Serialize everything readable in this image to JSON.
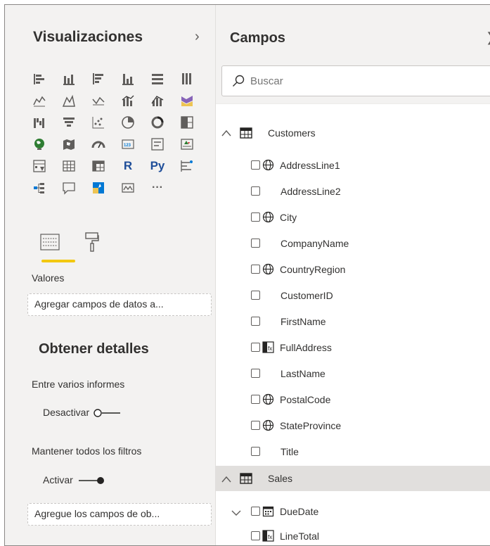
{
  "visualizations": {
    "title": "Visualizaciones",
    "collapse_icon": "chevron-right-icon",
    "icons": [
      [
        "stacked-bar-icon",
        "stacked-column-icon",
        "clustered-bar-icon",
        "clustered-column-icon",
        "100-bar-icon",
        "100-column-icon"
      ],
      [
        "line-chart-icon",
        "area-chart-icon",
        "stacked-area-icon",
        "line-column-icon",
        "line-clustered-icon",
        "ribbon-chart-icon"
      ],
      [
        "waterfall-icon",
        "funnel-icon",
        "scatter-icon",
        "pie-icon",
        "donut-icon",
        "treemap-icon"
      ],
      [
        "map-icon",
        "filled-map-icon",
        "gauge-icon",
        "card-icon",
        "multirow-card-icon",
        "kpi-icon"
      ],
      [
        "slicer-icon",
        "table-icon",
        "matrix-icon",
        "r-visual-icon",
        "python-visual-icon",
        "key-influencers-icon"
      ],
      [
        "decomposition-tree-icon",
        "qa-icon",
        "smart-narrative-icon",
        "paginated-report-icon",
        "more-icon"
      ]
    ],
    "r_label": "R",
    "py_label": "Py",
    "more_label": "···",
    "tabs": {
      "fields_tab_icon": "fields-well-icon",
      "format_tab_icon": "paint-roller-icon"
    },
    "values_label": "Valores",
    "values_well": "Agregar campos de datos a...",
    "drillthrough_title": "Obtener detalles",
    "cross_report_label": "Entre varios informes",
    "cross_report_toggle": "Desactivar",
    "keep_filters_label": "Mantener todos los filtros",
    "keep_filters_toggle": "Activar",
    "drillthrough_well": "Agregue los campos de ob..."
  },
  "fields_pane": {
    "title": "Campos",
    "close_icon": "close-icon",
    "search": {
      "placeholder": "Buscar",
      "value": ""
    },
    "tables": [
      {
        "name": "Customers",
        "expanded": true,
        "fields": [
          {
            "name": "AddressLine1",
            "icon": "globe-icon"
          },
          {
            "name": "AddressLine2",
            "icon": ""
          },
          {
            "name": "City",
            "icon": "globe-icon"
          },
          {
            "name": "CompanyName",
            "icon": ""
          },
          {
            "name": "CountryRegion",
            "icon": "globe-icon"
          },
          {
            "name": "CustomerID",
            "icon": ""
          },
          {
            "name": "FirstName",
            "icon": ""
          },
          {
            "name": "FullAddress",
            "icon": "calculated-column-icon"
          },
          {
            "name": "LastName",
            "icon": ""
          },
          {
            "name": "PostalCode",
            "icon": "globe-icon"
          },
          {
            "name": "StateProvince",
            "icon": "globe-icon"
          },
          {
            "name": "Title",
            "icon": ""
          }
        ]
      },
      {
        "name": "Sales",
        "expanded": true,
        "fields": [
          {
            "name": "DueDate",
            "icon": "calendar-icon",
            "expandable": true
          },
          {
            "name": "LineTotal",
            "icon": "calculated-column-icon"
          }
        ]
      }
    ]
  },
  "colors": {
    "accent": "#f2c811",
    "pane": "#f3f2f1",
    "selected_row": "#e1dfdd"
  }
}
